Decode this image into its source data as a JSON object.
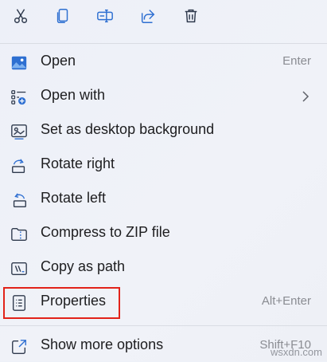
{
  "top_actions": [
    {
      "icon": "cut-icon"
    },
    {
      "icon": "copy-icon"
    },
    {
      "icon": "rename-icon"
    },
    {
      "icon": "share-icon"
    },
    {
      "icon": "delete-icon"
    }
  ],
  "items": [
    {
      "label": "Open",
      "shortcut": "Enter",
      "icon": "open-image-icon"
    },
    {
      "label": "Open with",
      "shortcut": "",
      "icon": "open-with-icon"
    },
    {
      "label": "Set as desktop background",
      "shortcut": "",
      "icon": "desktop-background-icon"
    },
    {
      "label": "Rotate right",
      "shortcut": "",
      "icon": "rotate-right-icon"
    },
    {
      "label": "Rotate left",
      "shortcut": "",
      "icon": "rotate-left-icon"
    },
    {
      "label": "Compress to ZIP file",
      "shortcut": "",
      "icon": "zip-icon"
    },
    {
      "label": "Copy as path",
      "shortcut": "",
      "icon": "copy-path-icon"
    },
    {
      "label": "Properties",
      "shortcut": "Alt+Enter",
      "icon": "properties-icon"
    },
    {
      "label": "Show more options",
      "shortcut": "Shift+F10",
      "icon": "show-more-icon"
    }
  ],
  "watermark": "wsxdn.com",
  "colors": {
    "accent": "#2e6fd1",
    "highlight_border": "#e2231a"
  }
}
